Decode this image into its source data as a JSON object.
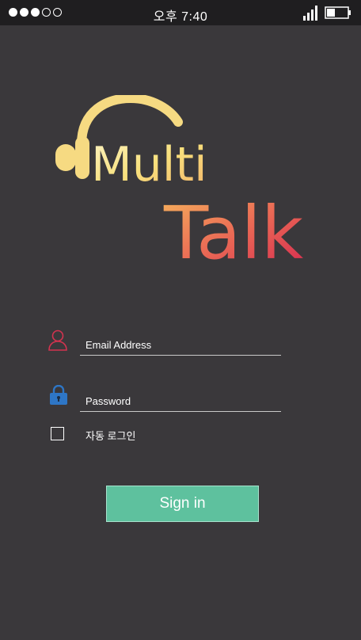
{
  "status_bar": {
    "time": "오후 7:40",
    "signal_dots_filled": 3,
    "signal_dots_total": 5,
    "battery_icon": "battery-icon",
    "cell_icon": "cell-signal-icon"
  },
  "logo": {
    "word1": "Multi",
    "word2": "Talk",
    "icon": "headphones-icon"
  },
  "form": {
    "email_placeholder": "Email Address",
    "password_placeholder": "Password",
    "auto_login_label": "자동 로그인",
    "auto_login_checked": false,
    "signin_label": "Sign in"
  },
  "colors": {
    "background": "#3a383b",
    "status_bar": "#1f1e20",
    "logo_gradient_start": "#f6e48a",
    "logo_gradient_end": "#d9325a",
    "user_icon": "#d3334f",
    "lock_icon": "#2e76c6",
    "signin_button": "#5ec19e"
  }
}
